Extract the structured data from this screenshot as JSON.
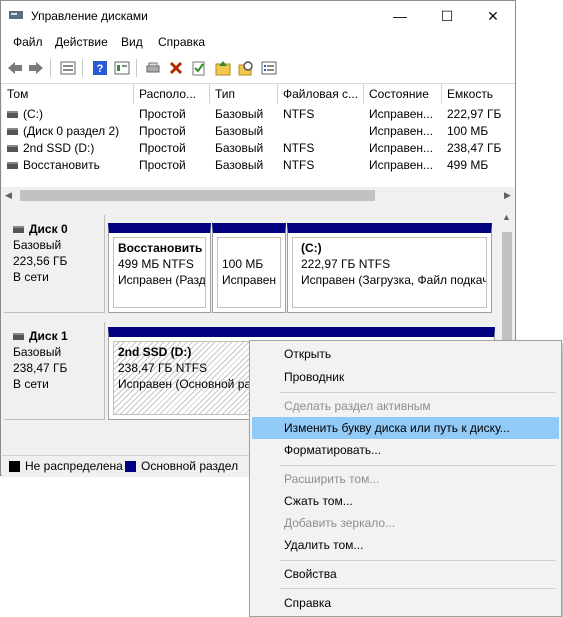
{
  "window": {
    "title": "Управление дисками",
    "controls": {
      "minimize": "—",
      "maximize": "☐",
      "close": "✕"
    }
  },
  "menubar": [
    "Файл",
    "Действие",
    "Вид",
    "Справка"
  ],
  "toolbar": {
    "icons": [
      "back-arrow-icon",
      "forward-arrow-icon",
      "disk-list-icon",
      "help-icon",
      "properties-icon",
      "connect-icon",
      "delete-icon",
      "check-icon",
      "folder-up-icon",
      "search-folder-icon",
      "settings-list-icon"
    ]
  },
  "volume_list": {
    "columns": [
      "Том",
      "Располо...",
      "Тип",
      "Файловая с...",
      "Состояние",
      "Емкость"
    ],
    "rows": [
      [
        "(C:)",
        "Простой",
        "Базовый",
        "NTFS",
        "Исправен...",
        "222,97 ГБ"
      ],
      [
        "(Диск 0 раздел 2)",
        "Простой",
        "Базовый",
        "",
        "Исправен...",
        "100 МБ"
      ],
      [
        "2nd SSD (D:)",
        "Простой",
        "Базовый",
        "NTFS",
        "Исправен...",
        "238,47 ГБ"
      ],
      [
        "Восстановить",
        "Простой",
        "Базовый",
        "NTFS",
        "Исправен...",
        "499 МБ"
      ]
    ]
  },
  "disks": [
    {
      "name": "Диск 0",
      "type": "Базовый",
      "size": "223,56 ГБ",
      "status": "В сети",
      "partitions": [
        {
          "name": "Восстановить",
          "size": "499 МБ NTFS",
          "status": "Исправен (Разд"
        },
        {
          "name": "",
          "size": "100 МБ",
          "status": "Исправен ("
        },
        {
          "name": "(C:)",
          "size": "222,97 ГБ NTFS",
          "status": "Исправен (Загрузка, Файл подкачк"
        }
      ]
    },
    {
      "name": "Диск 1",
      "type": "Базовый",
      "size": "238,47 ГБ",
      "status": "В сети",
      "partitions": [
        {
          "name": "2nd SSD  (D:)",
          "size": "238,47 ГБ NTFS",
          "status": "Исправен (Основной разд"
        }
      ]
    }
  ],
  "legend": [
    {
      "label": "Не распределена",
      "color": "#000000"
    },
    {
      "label": "Основной раздел",
      "color": "#000080"
    }
  ],
  "context_menu": {
    "items": [
      {
        "label": "Открыть",
        "enabled": true
      },
      {
        "label": "Проводник",
        "enabled": true
      },
      {
        "label": "Сделать раздел активным",
        "enabled": false
      },
      {
        "label": "Изменить букву диска или путь к диску...",
        "enabled": true,
        "highlighted": true
      },
      {
        "label": "Форматировать...",
        "enabled": true
      },
      {
        "label": "Расширить том...",
        "enabled": false
      },
      {
        "label": "Сжать том...",
        "enabled": true
      },
      {
        "label": "Добавить зеркало...",
        "enabled": false
      },
      {
        "label": "Удалить том...",
        "enabled": true
      },
      {
        "label": "Свойства",
        "enabled": true
      },
      {
        "label": "Справка",
        "enabled": true
      }
    ]
  },
  "colors": {
    "primary_partition": "#000080",
    "highlight": "#91c9f7"
  }
}
